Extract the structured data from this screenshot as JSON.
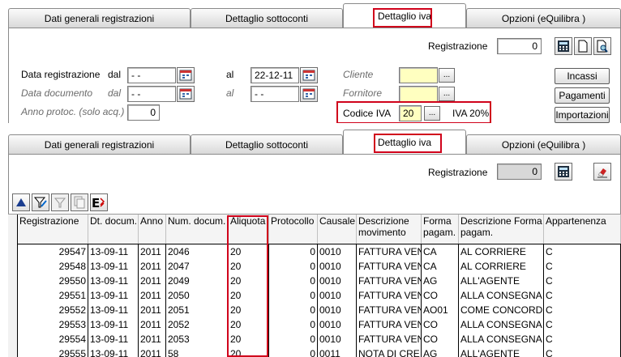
{
  "top": {
    "tabs": [
      {
        "label": "Dati generali registrazioni"
      },
      {
        "label": "Dettaglio sottoconti"
      },
      {
        "label": "Dettaglio iva"
      },
      {
        "label": "Opzioni (eQuilibra )"
      }
    ],
    "registrazione_label": "Registrazione",
    "registrazione_value": "0",
    "data_registrazione_label": "Data registrazione",
    "data_documento_label": "Data documento",
    "anno_protoc_label": "Anno protoc. (solo acq.)",
    "dal_label": "dal",
    "al_label": "al",
    "data_reg_dal": "- -",
    "data_reg_al": "22-12-11",
    "data_doc_dal": "- -",
    "data_doc_al": "- -",
    "anno_protoc_value": "0",
    "cliente_label": "Cliente",
    "fornitore_label": "Fornitore",
    "codice_iva_label": "Codice IVA",
    "codice_iva_value": "20",
    "codice_iva_desc": "IVA 20%",
    "ellipsis": "...",
    "buttons": {
      "incassi": "Incassi",
      "pagamenti": "Pagamenti",
      "importazioni": "Importazioni"
    }
  },
  "bottom": {
    "tabs": [
      {
        "label": "Dati generali registrazioni"
      },
      {
        "label": "Dettaglio sottoconti"
      },
      {
        "label": "Dettaglio iva"
      },
      {
        "label": "Opzioni (eQuilibra )"
      }
    ],
    "registrazione_label": "Registrazione",
    "registrazione_value": "0",
    "columns": {
      "registrazione": "Registrazione",
      "dt_docum": "Dt. docum.",
      "anno": "Anno",
      "num_docum": "Num. docum.",
      "aliquota": "Aliquota",
      "protocollo": "Protocollo",
      "causale": "Causale",
      "descr_mov_1": "Descrizione",
      "descr_mov_2": "movimento",
      "forma_pag_1": "Forma",
      "forma_pag_2": "pagam.",
      "descr_forma_1": "Descrizione Forma",
      "descr_forma_2": "pagam.",
      "appartenenza": "Appartenenza"
    },
    "rows": [
      {
        "reg": "29547",
        "dt": "13-09-11",
        "anno": "2011",
        "num": "2046",
        "aliq": "20",
        "prot": "0",
        "caus": "0010",
        "descr": "FATTURA VEN",
        "forma": "CA",
        "descr_forma": "AL CORRIERE",
        "app": "C"
      },
      {
        "reg": "29548",
        "dt": "13-09-11",
        "anno": "2011",
        "num": "2047",
        "aliq": "20",
        "prot": "0",
        "caus": "0010",
        "descr": "FATTURA VEN",
        "forma": "CA",
        "descr_forma": "AL CORRIERE",
        "app": "C"
      },
      {
        "reg": "29550",
        "dt": "13-09-11",
        "anno": "2011",
        "num": "2049",
        "aliq": "20",
        "prot": "0",
        "caus": "0010",
        "descr": "FATTURA VEN",
        "forma": "AG",
        "descr_forma": "ALL'AGENTE",
        "app": "C"
      },
      {
        "reg": "29551",
        "dt": "13-09-11",
        "anno": "2011",
        "num": "2050",
        "aliq": "20",
        "prot": "0",
        "caus": "0010",
        "descr": "FATTURA VEN",
        "forma": "CO",
        "descr_forma": "ALLA CONSEGNA",
        "app": "C"
      },
      {
        "reg": "29552",
        "dt": "13-09-11",
        "anno": "2011",
        "num": "2051",
        "aliq": "20",
        "prot": "0",
        "caus": "0010",
        "descr": "FATTURA VEN",
        "forma": "AO01",
        "descr_forma": "COME CONCORD",
        "app": "C"
      },
      {
        "reg": "29553",
        "dt": "13-09-11",
        "anno": "2011",
        "num": "2052",
        "aliq": "20",
        "prot": "0",
        "caus": "0010",
        "descr": "FATTURA VEN",
        "forma": "CO",
        "descr_forma": "ALLA CONSEGNA",
        "app": "C"
      },
      {
        "reg": "29554",
        "dt": "13-09-11",
        "anno": "2011",
        "num": "2053",
        "aliq": "20",
        "prot": "0",
        "caus": "0010",
        "descr": "FATTURA VEN",
        "forma": "CO",
        "descr_forma": "ALLA CONSEGNA",
        "app": "C"
      },
      {
        "reg": "29555",
        "dt": "13-09-11",
        "anno": "2011",
        "num": "58",
        "aliq": "20",
        "prot": "0",
        "caus": "0011",
        "descr": "NOTA DI CRE",
        "forma": "AG",
        "descr_forma": "ALL'AGENTE",
        "app": "C"
      }
    ]
  },
  "colors": {
    "highlight": "#d0021b",
    "yellow_field": "#ffffc0"
  },
  "icons": [
    "calendar-icon",
    "calculator-icon",
    "new-document-icon",
    "search-document-icon",
    "sort-up-icon",
    "edit-filter-icon",
    "filter-icon",
    "copy-icon",
    "export-icon",
    "eraser-icon"
  ]
}
